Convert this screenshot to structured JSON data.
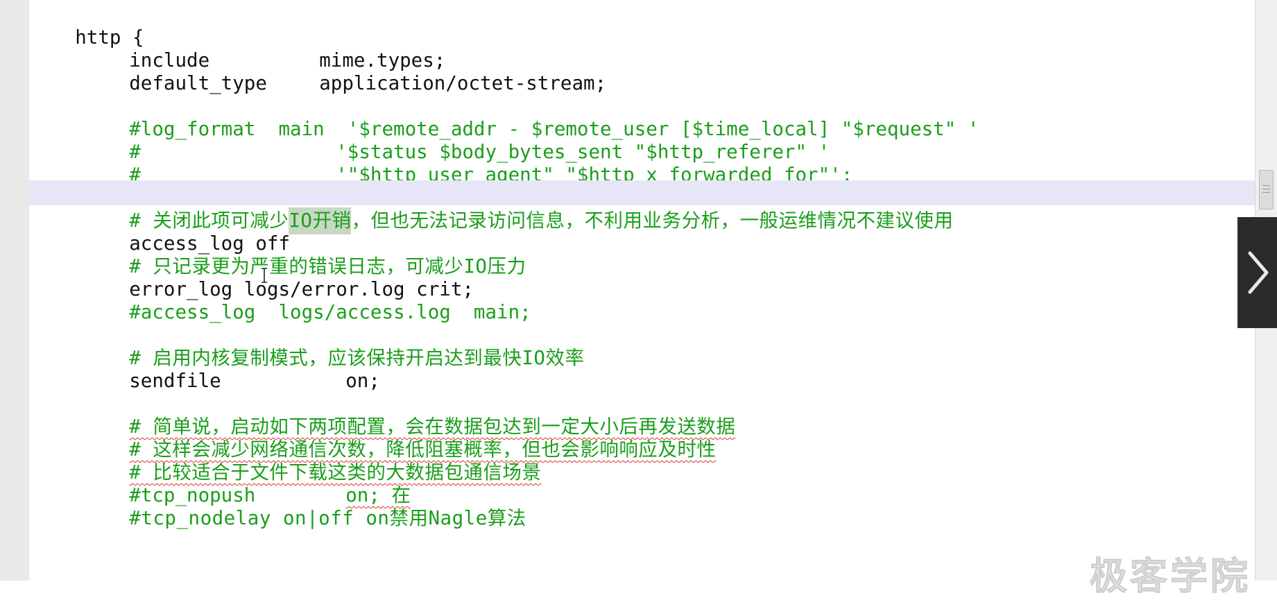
{
  "editor": {
    "lines": {
      "http_open": "http {",
      "include_key": "include",
      "include_val": "mime.types;",
      "default_type_key": "default_type",
      "default_type_val": "application/octet-stream;",
      "log_format_1": "#log_format  main  '$remote_addr - $remote_user [$time_local] \"$request\" '",
      "log_format_2": "#                 '$status $body_bytes_sent \"$http_referer\" '",
      "log_format_3": "#                 '\"$http_user_agent\" \"$http_x_forwarded_for\"';",
      "comment_io_pre": "# 关闭此项可减少",
      "comment_io_hl": "IO开销",
      "comment_io_post": "，但也无法记录访问信息，不利用业务分析，一般运维情况不建议使用",
      "access_log_off": "access_log off",
      "comment_error": "# 只记录更为严重的错误日志，可减少IO压力",
      "error_log": "error_log logs/error.log crit;",
      "access_log_main": "#access_log  logs/access.log  main;",
      "comment_sendfile": "# 启用内核复制模式，应该保持开启达到最快IO效率",
      "sendfile_key": "sendfile",
      "sendfile_val": "on;",
      "comment_simple_1": "# 简单说，启动如下两项配置，会在数据包达到一定大小后再发送数据",
      "comment_simple_2": "# 这样会减少网络通信次数，降低阻塞概率，但也会影响响应及时性",
      "comment_simple_3": "# 比较适合于文件下载这类的大数据包通信场景",
      "tcp_nopush_key": "#tcp_nopush",
      "tcp_nopush_val": "on; 在",
      "tcp_nodelay": "#tcp_nodelay on|off on禁用Nagle算法"
    }
  },
  "watermark": "极客学院",
  "colors": {
    "comment": "#1a9e1a",
    "highlight_row": "#e6e6f6",
    "search_highlight": "#c8d8c4",
    "spell_underline": "#e0302c"
  },
  "icons": {
    "next": "chevron-right-icon"
  }
}
